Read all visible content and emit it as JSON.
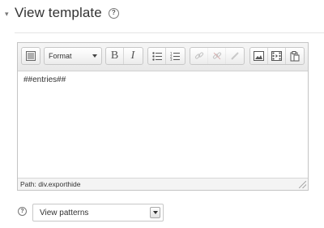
{
  "section": {
    "toggle_glyph": "▾",
    "title": "View template",
    "help_glyph": "?"
  },
  "editor": {
    "toolbar": {
      "format_label": "Format",
      "bold_glyph": "B",
      "italic_glyph": "I",
      "buttons": [
        "toolbar-toggle-icon",
        "bold-icon",
        "italic-icon",
        "unordered-list-icon",
        "ordered-list-icon",
        "link-icon",
        "unlink-icon",
        "anchor-icon",
        "image-icon",
        "media-icon",
        "paste-icon"
      ]
    },
    "content": "##entries##",
    "path_text": "Path: div.exporthide"
  },
  "patterns": {
    "help_glyph": "?",
    "selected": "View patterns"
  },
  "colors": {
    "border": "#c4c4c4",
    "toolbar_bg": "#ececec",
    "text": "#333333"
  }
}
